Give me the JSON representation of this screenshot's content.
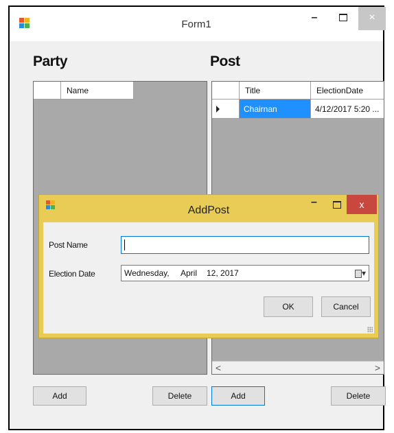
{
  "window": {
    "title": "Form1",
    "minimize": "–",
    "close": "×"
  },
  "party": {
    "label": "Party",
    "columns": [
      "Name"
    ],
    "add_label": "Add",
    "delete_label": "Delete"
  },
  "post": {
    "label": "Post",
    "columns": [
      "Title",
      "ElectionDate"
    ],
    "rows": [
      {
        "title": "Chairnan",
        "election_date": "4/12/2017 5:20 ..."
      }
    ],
    "add_label": "Add",
    "delete_label": "Delete",
    "scroll_left": "<",
    "scroll_right": ">"
  },
  "dialog": {
    "title": "AddPost",
    "minimize": "–",
    "close": "x",
    "post_name_label": "Post Name",
    "post_name_value": "",
    "election_date_label": "Election Date",
    "date": {
      "weekday": "Wednesday,",
      "month": "April",
      "day_year": "12, 2017"
    },
    "ok_label": "OK",
    "cancel_label": "Cancel"
  },
  "colors": {
    "selection": "#1e90ff",
    "dialog_frame": "#e8cc55",
    "dialog_close": "#c84840",
    "grid_background": "#a9a9a9"
  }
}
